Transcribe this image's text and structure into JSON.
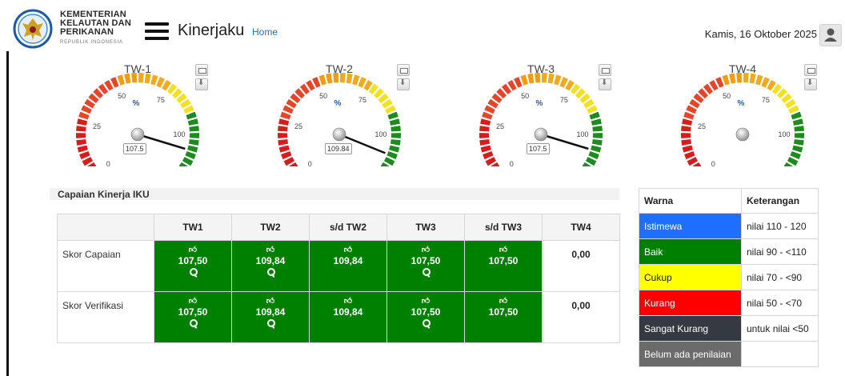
{
  "header": {
    "ministry_lines": [
      "KEMENTERIAN",
      "KELAUTAN DAN",
      "PERIKANAN"
    ],
    "ministry_sub": "REPUBLIK INDONESIA",
    "app_title": "Kinerjaku",
    "home_link": "Home",
    "date": "Kamis, 16 Oktober 2025",
    "icons": {
      "menu": "hamburger-icon",
      "user": "user-icon",
      "logo": "garuda-logo"
    }
  },
  "gauges": [
    {
      "title": "TW-1",
      "value": 107.5,
      "value_label": "107.5"
    },
    {
      "title": "TW-2",
      "value": 109.84,
      "value_label": "109.84"
    },
    {
      "title": "TW-3",
      "value": 107.5,
      "value_label": "107.5"
    },
    {
      "title": "TW-4",
      "value": null,
      "value_label": ""
    }
  ],
  "gauge_scale": {
    "min": 0,
    "max": 120,
    "ticks": [
      "0",
      "25",
      "50",
      "75",
      "100"
    ],
    "unit": "%"
  },
  "section_title": "Capaian Kinerja IKU",
  "iku_table": {
    "headers": [
      "",
      "TW1",
      "TW2",
      "s/d TW2",
      "TW3",
      "s/d TW3",
      "TW4"
    ],
    "rows": [
      {
        "label": "Skor Capaian",
        "values": [
          "107,50",
          "109,84",
          "109,84",
          "107,50",
          "107,50",
          "0,00"
        ]
      },
      {
        "label": "Skor Verifikasi",
        "values": [
          "107,50",
          "109,84",
          "109,84",
          "107,50",
          "107,50",
          "0,00"
        ]
      }
    ]
  },
  "legend": {
    "headers": [
      "Warna",
      "Keterangan"
    ],
    "rows": [
      {
        "label": "Istimewa",
        "desc": "nilai 110 - 120",
        "color": "#1f6fff",
        "text_color": "#ffffff"
      },
      {
        "label": "Baik",
        "desc": "nilai 90 - <110",
        "color": "#008000",
        "text_color": "#ffffff"
      },
      {
        "label": "Cukup",
        "desc": "nilai 70 - <90",
        "color": "#ffff00",
        "text_color": "#222222"
      },
      {
        "label": "Kurang",
        "desc": "nilai 50 - <70",
        "color": "#ff0000",
        "text_color": "#ffffff"
      },
      {
        "label": "Sangat Kurang",
        "desc": "untuk nilai <50",
        "color": "#343a40",
        "text_color": "#ffffff"
      },
      {
        "label": "Belum ada penilaian",
        "desc": "",
        "color": "#6b6b6b",
        "text_color": "#ffffff"
      }
    ]
  },
  "colors": {
    "green": "#008000",
    "link": "#2a6db5"
  }
}
